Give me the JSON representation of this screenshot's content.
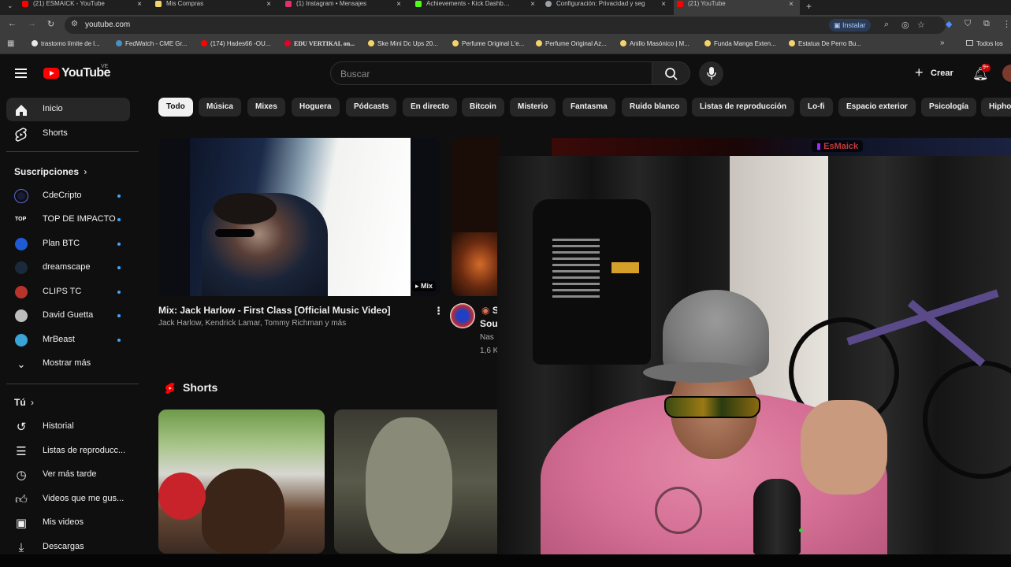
{
  "browser": {
    "tabs": [
      {
        "title": "(21) ESMAICK - YouTube",
        "color": "#ff0000"
      },
      {
        "title": "Mis Compras",
        "color": "#f5d36b"
      },
      {
        "title": "(1) Instagram • Mensajes",
        "color": "#e1306c"
      },
      {
        "title": "Achievements - Kick Dashboard",
        "color": "#53fc18"
      },
      {
        "title": "Configuración: Privacidad y seg",
        "color": "#9aa0a6"
      },
      {
        "title": "(21) YouTube",
        "color": "#ff0000"
      }
    ],
    "url": "youtube.com",
    "install_label": "Instalar",
    "bookmarks": [
      "trastorno límite de l...",
      "FedWatch - CME Gr...",
      "(174) Hades66 -OU...",
      "EDU VERTIKAL on...",
      "Ske Mini Dc Ups 20...",
      "Perfume Original L'e...",
      "Perfume Original Az...",
      "Anillo Masónico | M...",
      "Funda Manga Exten...",
      "Estatua De Perro Bu..."
    ],
    "all_bookmarks": "Todos los"
  },
  "youtube": {
    "logo_text": "YouTube",
    "region": "VE",
    "search_placeholder": "Buscar",
    "create_label": "Crear",
    "notif_badge": "9+",
    "sidebar": {
      "main": [
        {
          "label": "Inicio",
          "icon": "home-icon"
        },
        {
          "label": "Shorts",
          "icon": "shorts-icon"
        }
      ],
      "subs_title": "Suscripciones",
      "subs": [
        {
          "label": "CdeCripto",
          "color": "#3a3a8a"
        },
        {
          "label": "TOP DE IMPACTO",
          "color": "#222222"
        },
        {
          "label": "Plan BTC",
          "color": "#1e5bd6"
        },
        {
          "label": "dreamscape",
          "color": "#1b2a3a"
        },
        {
          "label": "CLIPS TC",
          "color": "#b8342a"
        },
        {
          "label": "David Guetta",
          "color": "#d9d9d9"
        },
        {
          "label": "MrBeast",
          "color": "#3aa3d9"
        }
      ],
      "show_more": "Mostrar más",
      "you_title": "Tú",
      "you": [
        {
          "label": "Historial",
          "icon": "history-icon"
        },
        {
          "label": "Listas de reproducc...",
          "icon": "playlist-icon"
        },
        {
          "label": "Ver más tarde",
          "icon": "clock-icon"
        },
        {
          "label": "Videos que me gus...",
          "icon": "like-icon"
        },
        {
          "label": "Mis videos",
          "icon": "my-videos-icon"
        },
        {
          "label": "Descargas",
          "icon": "download-icon"
        }
      ]
    },
    "chips": [
      "Todo",
      "Música",
      "Mixes",
      "Hoguera",
      "Pódcasts",
      "En directo",
      "Bitcoin",
      "Misterio",
      "Fantasma",
      "Ruido blanco",
      "Listas de reproducción",
      "Lo-fi",
      "Espacio exterior",
      "Psicología",
      "Hiphop"
    ],
    "video1": {
      "title": "Mix: Jack Harlow - First Class [Official Music Video]",
      "meta": "Jack Harlow, Kendrick Lamar, Tommy Richman y más",
      "badge": "Mix"
    },
    "video2": {
      "title_a": "S",
      "title_b": "Sou",
      "channel": "Nas",
      "views": "1,6 K"
    },
    "shorts_title": "Shorts",
    "stream_tag": "EsMaick"
  }
}
